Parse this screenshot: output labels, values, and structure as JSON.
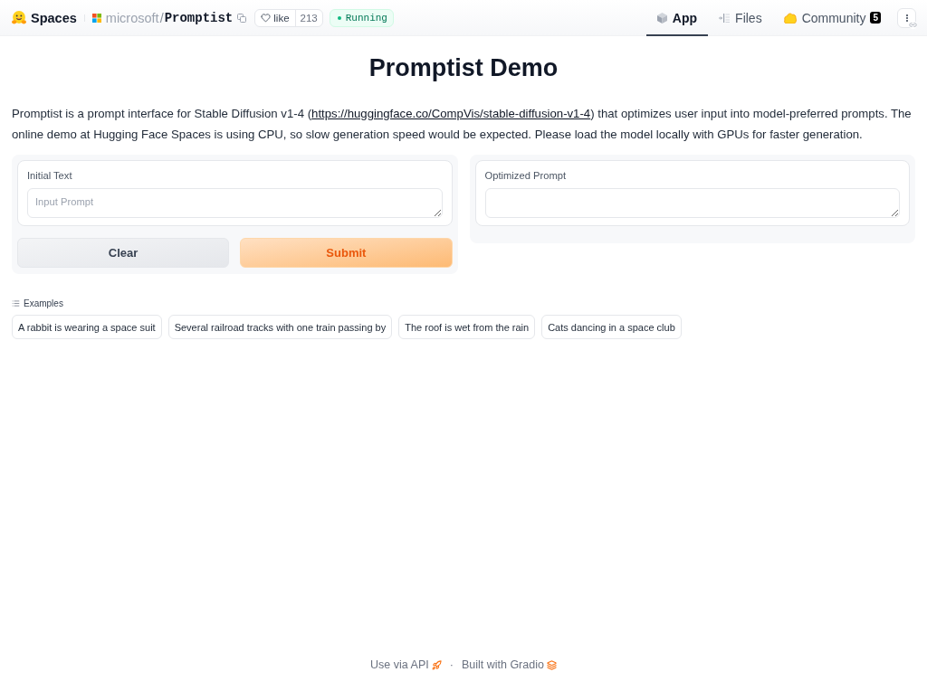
{
  "header": {
    "brand": "Spaces",
    "owner": "microsoft",
    "separator": "/",
    "repo": "Promptist",
    "like": {
      "label": "like",
      "count": "213"
    },
    "status": {
      "label": "Running"
    },
    "tabs": [
      {
        "label": "App",
        "kind": "app",
        "selected": true
      },
      {
        "label": "Files",
        "kind": "files",
        "selected": false
      },
      {
        "label": "Community",
        "kind": "community",
        "selected": false,
        "badge": "5"
      }
    ]
  },
  "title": "Promptist Demo",
  "intro": {
    "text_before": "Promptist is a prompt interface for Stable Diffusion v1-4 (",
    "link": "https://huggingface.co/CompVis/stable-diffusion-v1-4",
    "text_after": ") that optimizes user input into model-preferred prompts. The online demo at Hugging Face Spaces is using CPU, so slow generation speed would be expected. Please load the model locally with GPUs for faster generation."
  },
  "input_panel": {
    "label": "Initial Text",
    "placeholder": "Input Prompt",
    "buttons": [
      {
        "label": "Clear",
        "kind": "secondary"
      },
      {
        "label": "Submit",
        "kind": "primary"
      }
    ]
  },
  "output_panel": {
    "label": "Optimized Prompt"
  },
  "examples": {
    "label": "Examples",
    "items": [
      "A rabbit is wearing a space suit",
      "Several railroad tracks with one train passing by",
      "The roof is wet from the rain",
      "Cats dancing in a space club"
    ]
  },
  "footer": {
    "links": [
      {
        "label": "Use via API",
        "kind": "api"
      },
      {
        "label": "Built with Gradio",
        "kind": "gradio"
      }
    ],
    "separator": "·"
  }
}
